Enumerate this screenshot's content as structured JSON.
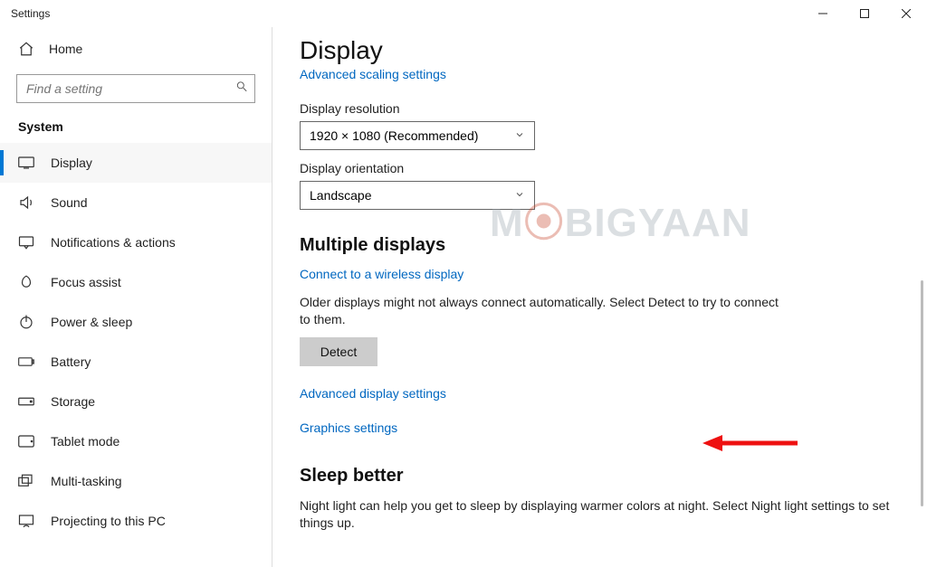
{
  "window": {
    "title": "Settings"
  },
  "sidebar": {
    "home": "Home",
    "search_placeholder": "Find a setting",
    "section": "System",
    "items": [
      {
        "label": "Display"
      },
      {
        "label": "Sound"
      },
      {
        "label": "Notifications & actions"
      },
      {
        "label": "Focus assist"
      },
      {
        "label": "Power & sleep"
      },
      {
        "label": "Battery"
      },
      {
        "label": "Storage"
      },
      {
        "label": "Tablet mode"
      },
      {
        "label": "Multi-tasking"
      },
      {
        "label": "Projecting to this PC"
      }
    ]
  },
  "content": {
    "title": "Display",
    "cut_link": "Advanced scaling settings",
    "resolution_label": "Display resolution",
    "resolution_value": "1920 × 1080 (Recommended)",
    "orientation_label": "Display orientation",
    "orientation_value": "Landscape",
    "multi_heading": "Multiple displays",
    "connect_link": "Connect to a wireless display",
    "older_text": "Older displays might not always connect automatically. Select Detect to try to connect to them.",
    "detect_button": "Detect",
    "adv_display_link": "Advanced display settings",
    "graphics_link": "Graphics settings",
    "sleep_heading": "Sleep better",
    "sleep_text": "Night light can help you get to sleep by displaying warmer colors at night. Select Night light settings to set things up."
  },
  "watermark": "M   BIGYAAN"
}
